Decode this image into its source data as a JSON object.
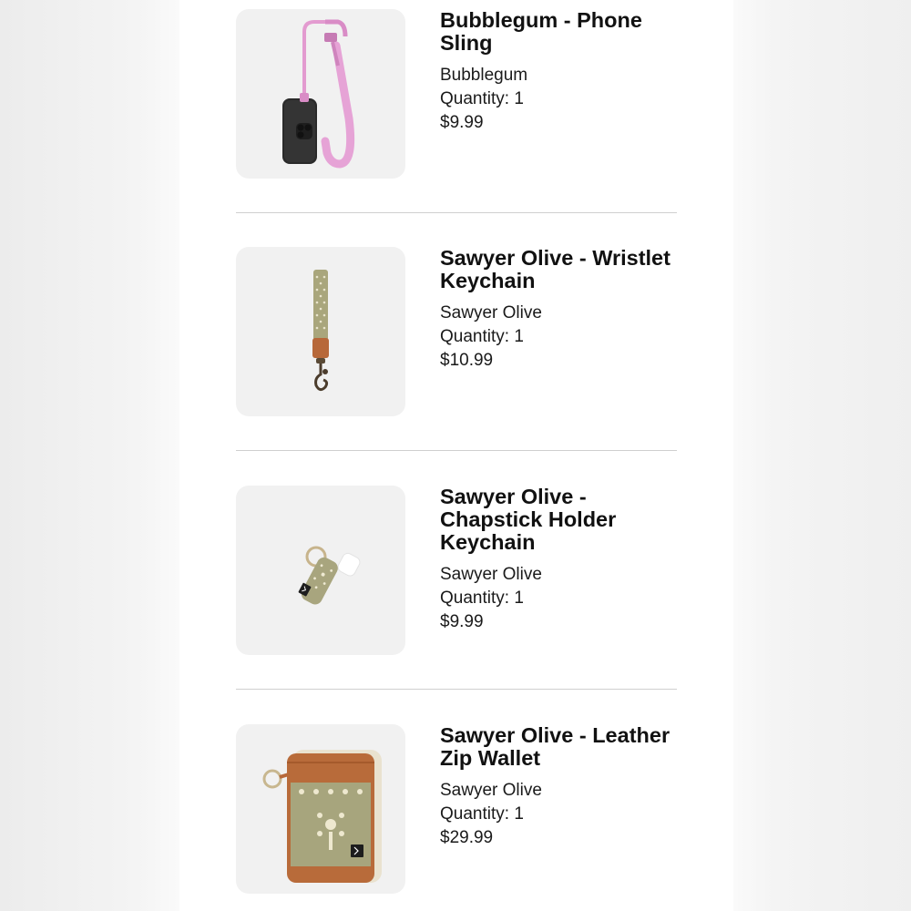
{
  "items": [
    {
      "title": "Bubblegum - Phone Sling",
      "variant": "Bubblegum",
      "quantity": "Quantity: 1",
      "price": "$9.99",
      "image": "phone-sling-image"
    },
    {
      "title": "Sawyer Olive - Wristlet Keychain",
      "variant": "Sawyer Olive",
      "quantity": "Quantity: 1",
      "price": "$10.99",
      "image": "wristlet-keychain-image"
    },
    {
      "title": "Sawyer Olive - Chapstick Holder Keychain",
      "variant": "Sawyer Olive",
      "quantity": "Quantity: 1",
      "price": "$9.99",
      "image": "chapstick-holder-image"
    },
    {
      "title": "Sawyer Olive - Leather Zip Wallet",
      "variant": "Sawyer Olive",
      "quantity": "Quantity: 1",
      "price": "$29.99",
      "image": "zip-wallet-image"
    }
  ],
  "colors": {
    "bubblegum_pink": "#e59ad3",
    "sawyer_olive": "#a8a57e",
    "leather_brown": "#b86b3a"
  }
}
